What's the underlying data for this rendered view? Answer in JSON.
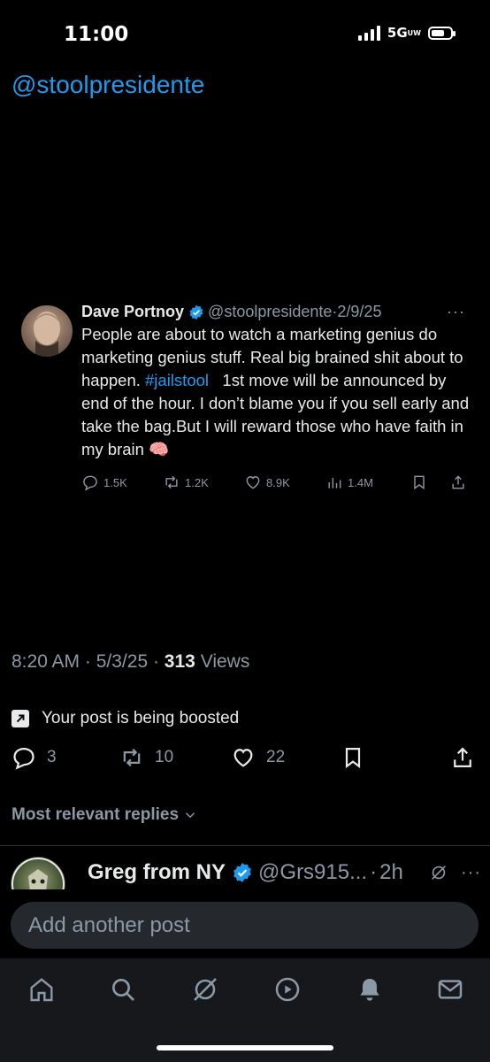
{
  "status": {
    "time": "11:00",
    "network": "5G",
    "network_sub": "UW"
  },
  "header": {
    "handle": "@stoolpresidente"
  },
  "quoted_post": {
    "name": "Dave Portnoy",
    "handle": "@stoolpresidente",
    "date": "2/9/25",
    "text_before": "People are about to watch a marketing genius do marketing genius stuff. Real big brained shit about to happen. ",
    "hashtag": "#jailstool",
    "text_after": "   1st move will be announced by end of the hour. I don’t blame you if you sell early and take the bag.But I will reward those who have faith in my brain 🧠",
    "stats": {
      "replies": "1.5K",
      "reposts": "1.2K",
      "likes": "8.9K",
      "views": "1.4M"
    },
    "icons": [
      "verified-icon",
      "more-icon",
      "reply-icon",
      "repost-icon",
      "like-icon",
      "views-icon",
      "bookmark-icon",
      "share-icon"
    ]
  },
  "post_meta": {
    "time": "8:20 AM",
    "date": "5/3/25",
    "views_count": "313",
    "views_label": "Views"
  },
  "boost": {
    "text": "Your post is being boosted"
  },
  "post_actions": {
    "replies": "3",
    "reposts": "10",
    "likes": "22"
  },
  "replies": {
    "sort_label": "Most relevant replies"
  },
  "reply_preview": {
    "name": "Greg from NY",
    "handle": "@Grs915...",
    "time": "2h"
  },
  "compose": {
    "placeholder": "Add another post"
  },
  "tabbar": {
    "items": [
      "home-icon",
      "search-icon",
      "grok-icon",
      "video-icon",
      "notifications-icon",
      "messages-icon"
    ]
  },
  "colors": {
    "accent": "#1d9bf0",
    "muted": "#8b98a5",
    "text": "#e7e9ea",
    "background": "#000000"
  }
}
